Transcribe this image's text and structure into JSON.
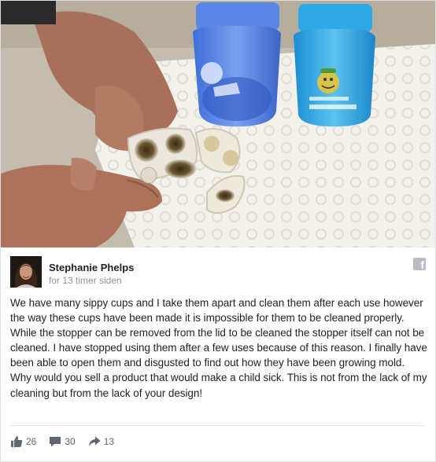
{
  "post": {
    "author": "Stephanie Phelps",
    "timestamp": "for 13 timer siden",
    "text": "We have many sippy cups and I take them apart and clean them after each use however the way these cups have been made it is impossible for them to be cleaned properly. While the stopper can be removed from the lid to be cleaned the stopper itself can not be cleaned. I have stopped using them after a few uses because of this reason. I finally have been able to open them and disgusted to find out how they have been growing mold. Why would you sell a product that would make a child sick. This is not from the lack of my cleaning but from the lack of your design!"
  },
  "actions": {
    "likes": "26",
    "comments": "30",
    "shares": "13"
  },
  "icons": {
    "platform": "facebook-icon",
    "like": "thumbs-up-icon",
    "comment": "speech-bubble-icon",
    "share": "share-arrow-icon"
  },
  "colors": {
    "name": "#1d2129",
    "meta": "#90949c",
    "icon": "#606770",
    "cup_left": "#4f7fe0",
    "cup_right": "#2aa0df"
  }
}
